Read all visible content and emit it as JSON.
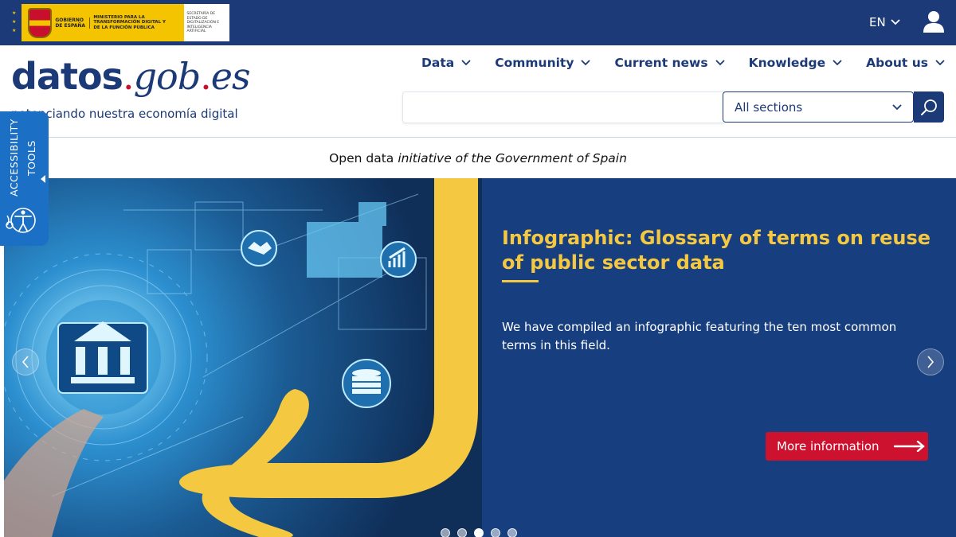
{
  "gov_bar": {
    "logo": {
      "gobierno": "GOBIERNO DE ESPAÑA",
      "ministerio": "MINISTERIO PARA LA TRANSFORMACIÓN DIGITAL Y DE LA FUNCIÓN PÚBLICA",
      "secretaria": "SECRETARÍA DE ESTADO DE DIGITALIZACIÓN E INTELIGENCIA ARTIFICIAL"
    },
    "language": "EN",
    "user_icon": "user-icon"
  },
  "header": {
    "logo_part1": "datos",
    "logo_dot1": ".",
    "logo_part2": "gob",
    "logo_dot2": ".",
    "logo_part3": "es",
    "tagline": "potenciando nuestra economía digital"
  },
  "nav": {
    "items": [
      {
        "label": "Data"
      },
      {
        "label": "Community"
      },
      {
        "label": "Current news"
      },
      {
        "label": "Knowledge"
      },
      {
        "label": "About us"
      }
    ]
  },
  "search": {
    "value": "",
    "placeholder": "",
    "section_selected": "All sections",
    "button_icon": "search-icon"
  },
  "accessibility": {
    "line1": "ACCESSIBILITY",
    "line2": "TOOLS",
    "icon": "accessibility-icon"
  },
  "initiative": {
    "plain": "Open data",
    "italic": "initiative of the Government of Spain"
  },
  "hero": {
    "title": "Infographic: Glossary of terms on reuse of public sector data",
    "description": "We have compiled an infographic featuring the ten most common terms in this field.",
    "button_label": "More information",
    "slide_count": 5,
    "active_slide": 3
  },
  "colors": {
    "navy": "#1b3a77",
    "hero_bg": "#173e7e",
    "accent_yellow": "#f5c842",
    "cta_red": "#cd1230",
    "a11y_blue": "#1b6fc4"
  }
}
